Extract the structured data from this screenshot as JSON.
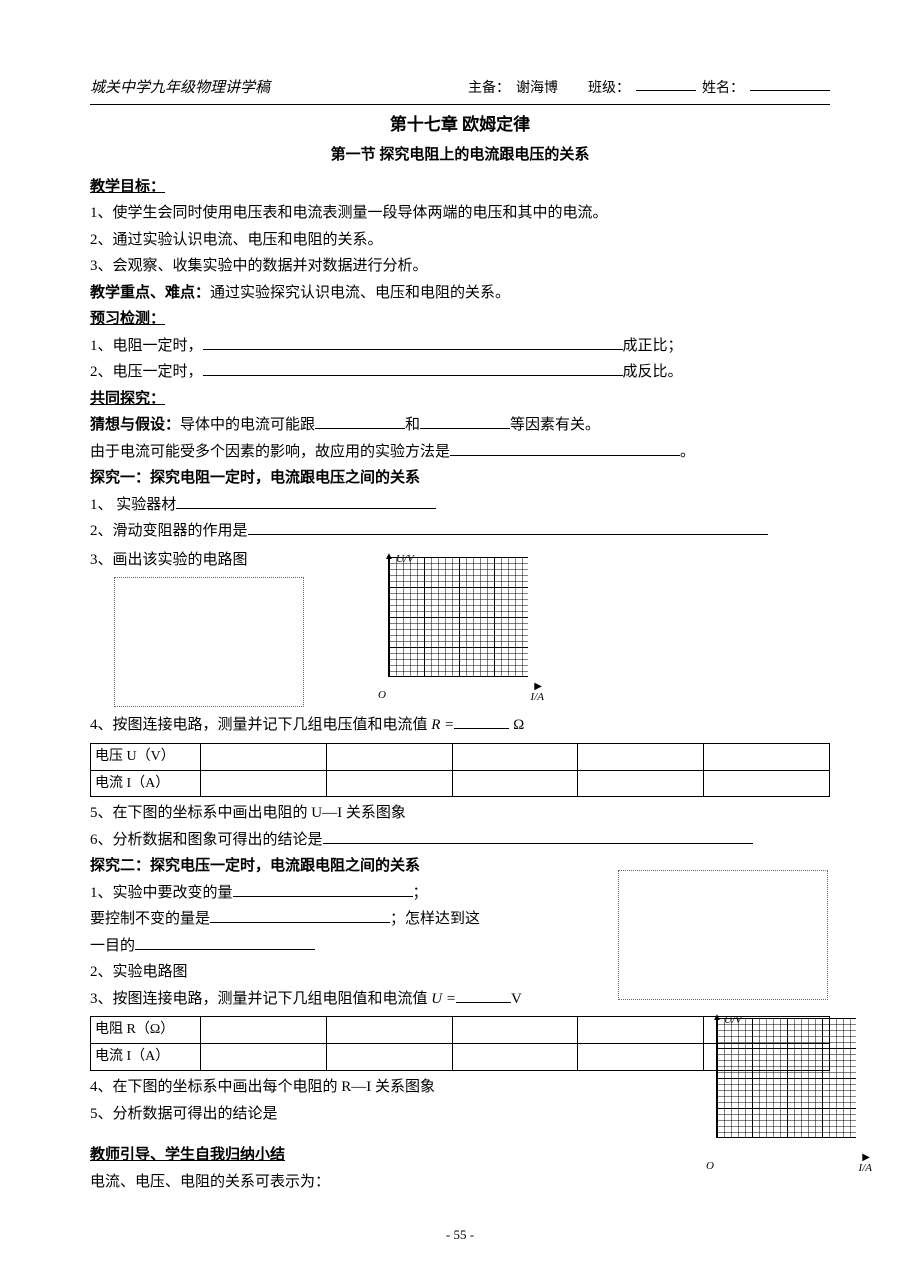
{
  "header": {
    "school": "城关中学九年级物理讲学稿",
    "prep_label": "主备：",
    "prep_name": "谢海博",
    "class_label": "班级：",
    "name_label": "姓名："
  },
  "title": {
    "chapter": "第十七章  欧姆定律",
    "section": "第一节  探究电阻上的电流跟电压的关系"
  },
  "goals": {
    "heading": "教学目标：",
    "g1": "1、使学生会同时使用电压表和电流表测量一段导体两端的电压和其中的电流。",
    "g2": "2、通过实验认识电流、电压和电阻的关系。",
    "g3": "3、会观察、收集实验中的数据并对数据进行分析。"
  },
  "difficulty": {
    "label": "教学重点、难点：",
    "text": "通过实验探究认识电流、电压和电阻的关系。"
  },
  "preview": {
    "heading": "预习检测：",
    "p1a": "1、电阻一定时，",
    "p1b": "成正比；",
    "p2a": "2、电压一定时，",
    "p2b": "成反比。"
  },
  "explore": {
    "heading": "共同探究：",
    "hyp_label": "猜想与假设：",
    "hyp_a": "导体中的电流可能跟",
    "hyp_b": "和",
    "hyp_c": "等因素有关。",
    "method": "由于电流可能受多个因素的影响，故应用的实验方法是"
  },
  "inv1": {
    "heading": "探究一：探究电阻一定时，电流跟电压之间的关系",
    "i1": "1、 实验器材",
    "i2": "2、滑动变阻器的作用是",
    "i3": "3、画出该实验的电路图",
    "grid": {
      "ylabel": "U/V",
      "xlabel": "I/A",
      "origin": "O"
    },
    "i4a": "4、按图连接电路，测量并记下几组电压值和电流值 ",
    "i4r": "R =",
    "i4unit": "Ω",
    "table": {
      "r1": "电压 U（V）",
      "r2": "电流 I（A）"
    },
    "i5": "5、在下图的坐标系中画出电阻的 U—I 关系图象",
    "i6": "6、分析数据和图象可得出的结论是"
  },
  "inv2": {
    "heading": "探究二：探究电压一定时，电流跟电阻之间的关系",
    "i1a": "1、实验中要改变的量",
    "i1b": "；",
    "i1c": "   要控制不变的量是",
    "i1d": "；怎样达到这",
    "i1e": "   一目的",
    "i2": "2、实验电路图",
    "i3a": "3、按图连接电路，测量并记下几组电阻值和电流值 ",
    "i3u": "U =",
    "i3unit": "V",
    "table": {
      "r1": "电阻 R（Ω）",
      "r2": "电流 I（A）"
    },
    "i4": "4、在下图的坐标系中画出每个电阻的 R—I 关系图象",
    "i5": "5、分析数据可得出的结论是",
    "grid": {
      "ylabel": "U/V",
      "xlabel": "I/A",
      "origin": "O"
    }
  },
  "summary": {
    "heading": "教师引导、学生自我归纳小结",
    "text": "电流、电压、电阻的关系可表示为："
  },
  "footer": "- 55 -"
}
